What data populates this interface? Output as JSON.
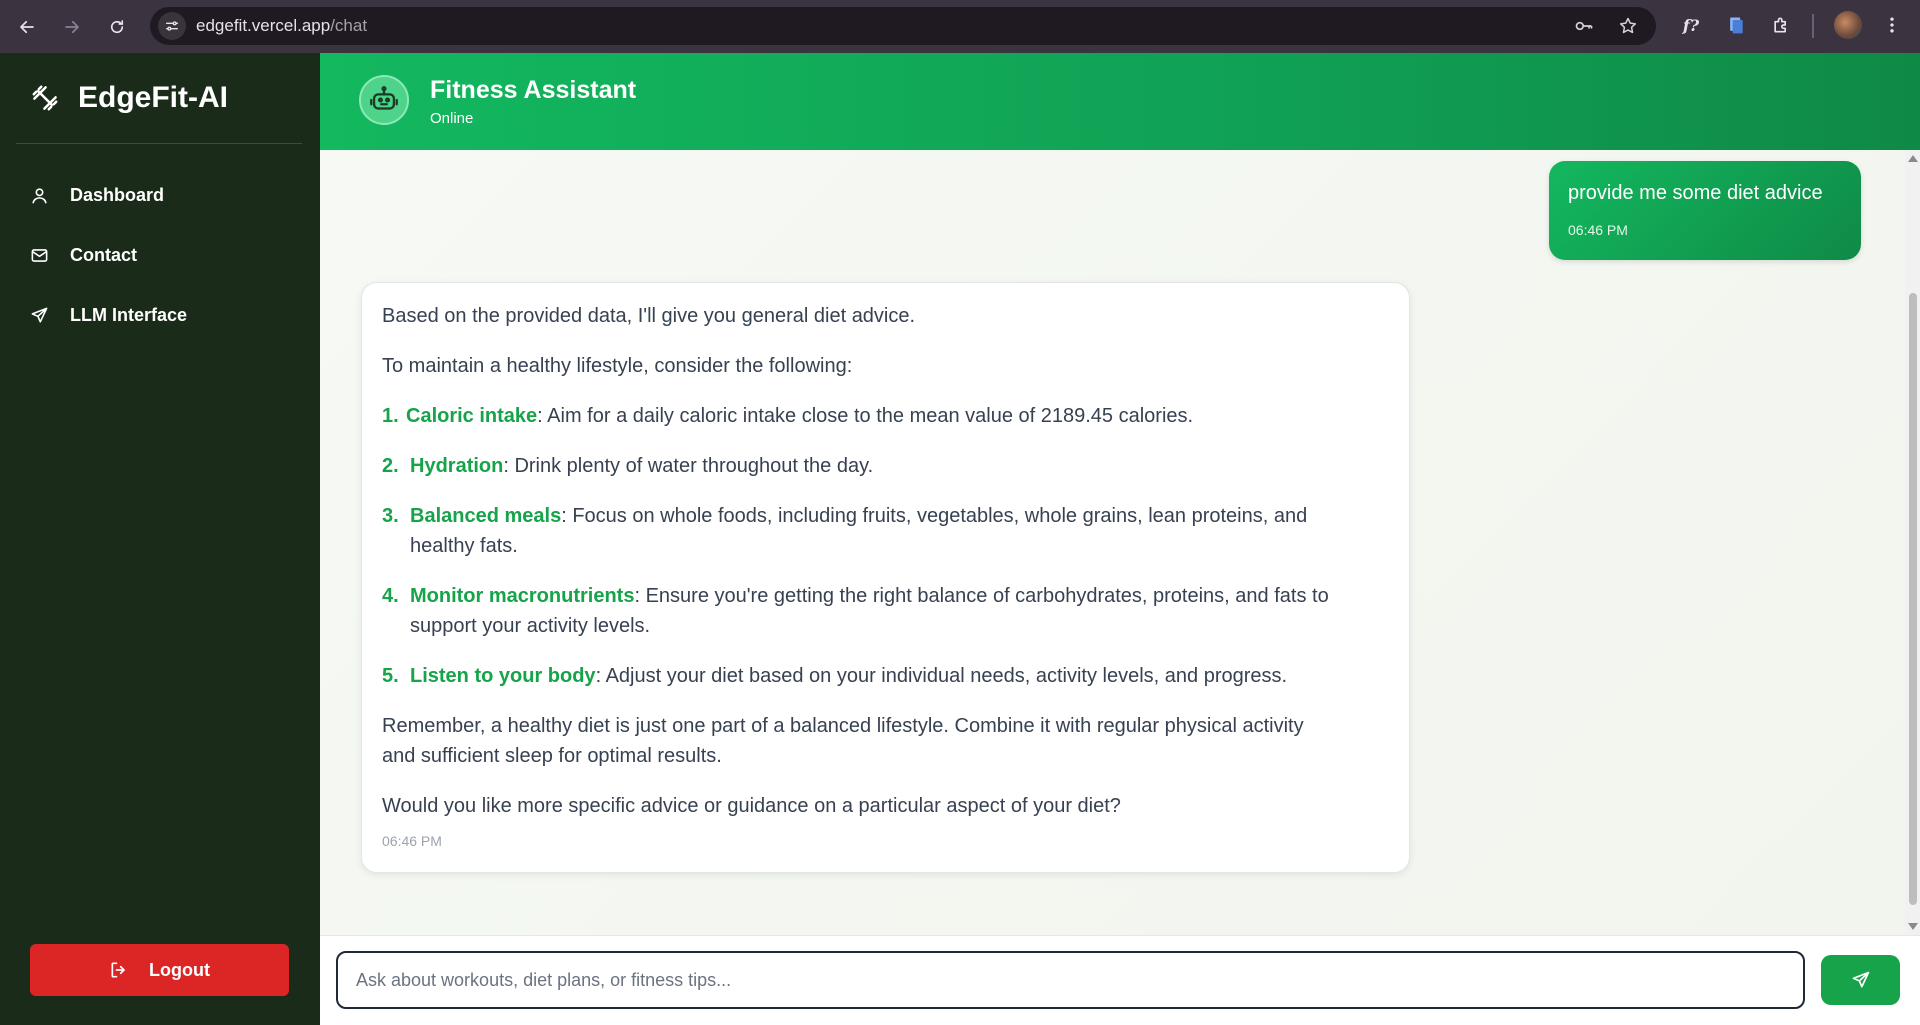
{
  "browser": {
    "url_host": "edgefit.vercel.app",
    "url_path": "/chat",
    "icons": [
      "back-icon",
      "forward-icon",
      "reload-icon",
      "site-info-icon",
      "password-key-icon",
      "bookmark-star-icon",
      "extension-f-icon",
      "extension-docs-icon",
      "extensions-puzzle-icon",
      "profile-avatar",
      "menu-dots-icon"
    ]
  },
  "sidebar": {
    "brand": "EdgeFit-AI",
    "items": [
      {
        "label": "Dashboard",
        "icon": "user-icon"
      },
      {
        "label": "Contact",
        "icon": "mail-icon"
      },
      {
        "label": "LLM Interface",
        "icon": "send-icon"
      }
    ],
    "logout_label": "Logout"
  },
  "header": {
    "title": "Fitness Assistant",
    "status": "Online"
  },
  "messages": {
    "user": {
      "text": "provide me some diet advice",
      "time": "06:46 PM"
    },
    "bot": {
      "intro": "Based on the provided data, I'll give you general diet advice.",
      "lead": "To maintain a healthy lifestyle, consider the following:",
      "items": [
        {
          "num": "1.",
          "term": "Caloric intake",
          "text": ": Aim for a daily caloric intake close to the mean value of 2189.45 calories."
        },
        {
          "num": "2.",
          "term": "Hydration",
          "text": ": Drink plenty of water throughout the day."
        },
        {
          "num": "3.",
          "term": "Balanced meals",
          "text": ": Focus on whole foods, including fruits, vegetables, whole grains, lean proteins, and",
          "text2": "healthy fats."
        },
        {
          "num": "4.",
          "term": "Monitor macronutrients",
          "text": ": Ensure you're getting the right balance of carbohydrates, proteins, and fats to",
          "text2": "support your activity levels."
        },
        {
          "num": "5.",
          "term": "Listen to your body",
          "text": ": Adjust your diet based on your individual needs, activity levels, and progress."
        }
      ],
      "remember_1": "Remember, a healthy diet is just one part of a balanced lifestyle. Combine it with regular physical activity",
      "remember_2": "and sufficient sleep for optimal results.",
      "question": "Would you like more specific advice or guidance on a particular aspect of your diet?",
      "time": "06:46 PM"
    }
  },
  "input": {
    "placeholder": "Ask about workouts, diet plans, or fitness tips...",
    "value": ""
  },
  "colors": {
    "accent": "#16a34a",
    "sidebar_bg": "#1a2b1a",
    "logout": "#dc2626"
  }
}
